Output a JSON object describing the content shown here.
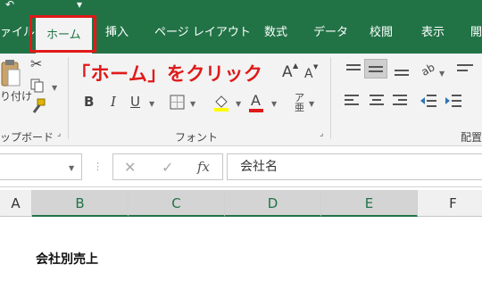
{
  "tabs": [
    {
      "label": "ァイル"
    },
    {
      "label": "ホーム"
    },
    {
      "label": "挿入"
    },
    {
      "label": "ページ レイアウト"
    },
    {
      "label": "数式"
    },
    {
      "label": "データ"
    },
    {
      "label": "校閲"
    },
    {
      "label": "表示"
    },
    {
      "label": "開"
    }
  ],
  "annotation": "「ホーム」をクリック",
  "ribbon": {
    "paste_label": "り付け",
    "clipboard_label": "ップボード",
    "font_label": "フォント",
    "align_label": "配置",
    "font_grow": "A",
    "font_shrink": "A",
    "bold": "B",
    "italic": "I",
    "underline": "U",
    "font_color_glyph": "A",
    "text_direction_glyph": "ab"
  },
  "formula_bar": {
    "cancel_glyph": "✕",
    "enter_glyph": "✓",
    "fx": "fx",
    "value": "会社名"
  },
  "columns": [
    "A",
    "B",
    "C",
    "D",
    "E",
    "F"
  ],
  "sheet": {
    "cell_text": "会社別売上"
  },
  "colors": {
    "excel_green": "#217346",
    "annotation_red": "#e01919"
  }
}
